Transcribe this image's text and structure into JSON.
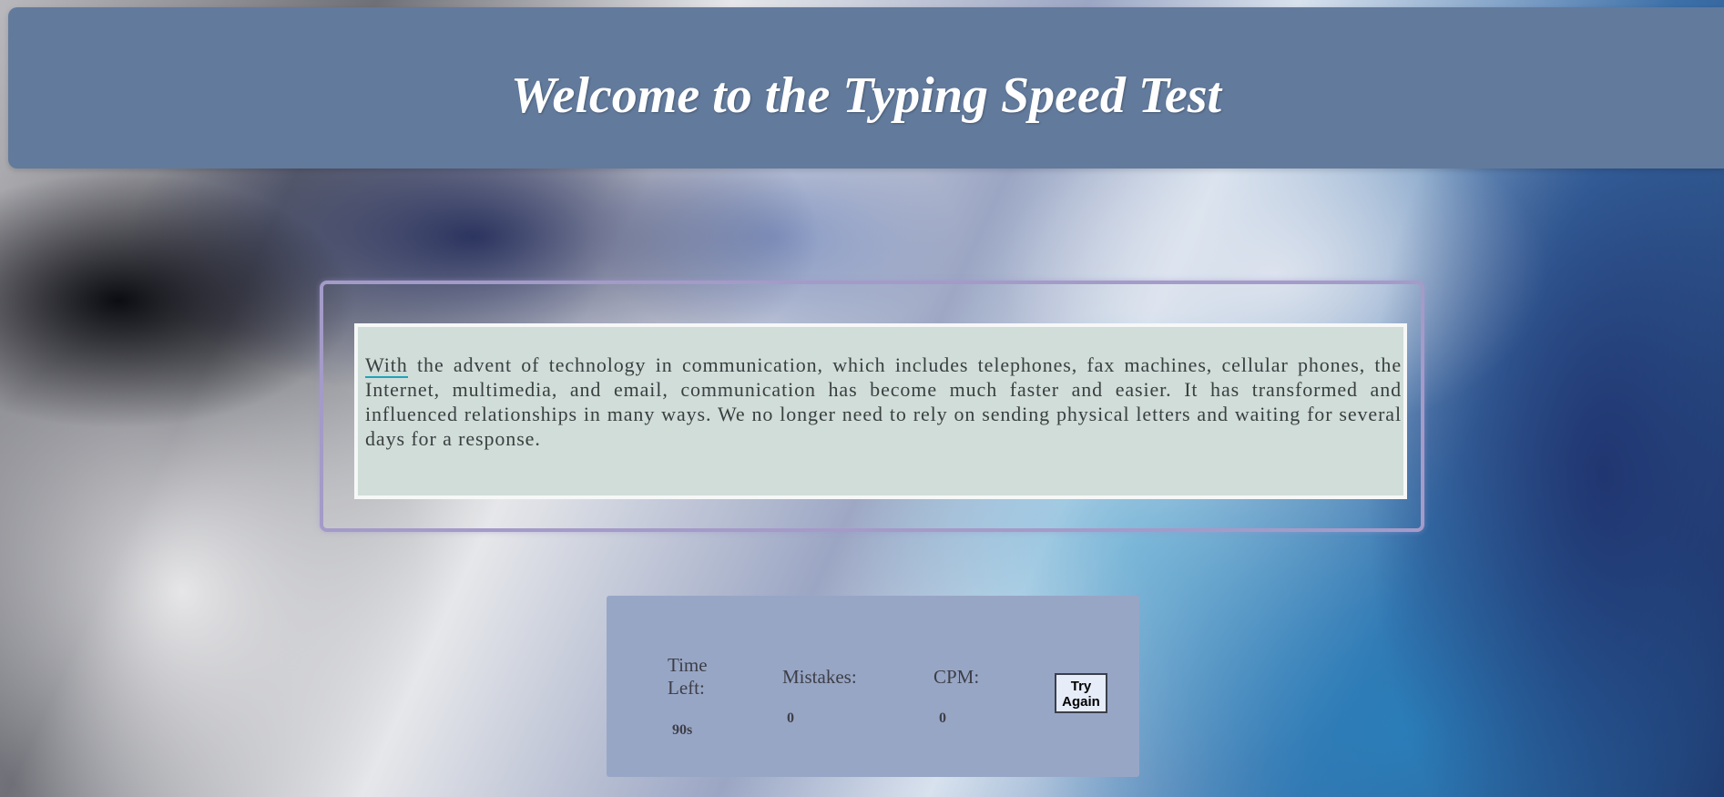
{
  "header": {
    "title": "Welcome to the Typing Speed Test"
  },
  "typing_text": {
    "current_word": "With",
    "rest": " the advent of technology in communication, which includes telephones, fax machines, cellular phones, the Internet, multimedia, and email, communication has become much faster and easier. It has transformed and influenced relationships in many ways. We no longer need to rely on sending physical letters and waiting for several days for a response."
  },
  "stats": {
    "time_left_label": "Time Left:",
    "time_left_value": "90s",
    "mistakes_label": "Mistakes:",
    "mistakes_value": "0",
    "cpm_label": "CPM:",
    "cpm_value": "0",
    "try_again_label": "Try Again"
  },
  "colors": {
    "header_bg": "#627a9c",
    "text_box_bg": "#d0ddd9",
    "frame_border": "#a49bc8",
    "stats_bg": "#98a6c6",
    "cursor_underline": "#1fa3b8"
  }
}
